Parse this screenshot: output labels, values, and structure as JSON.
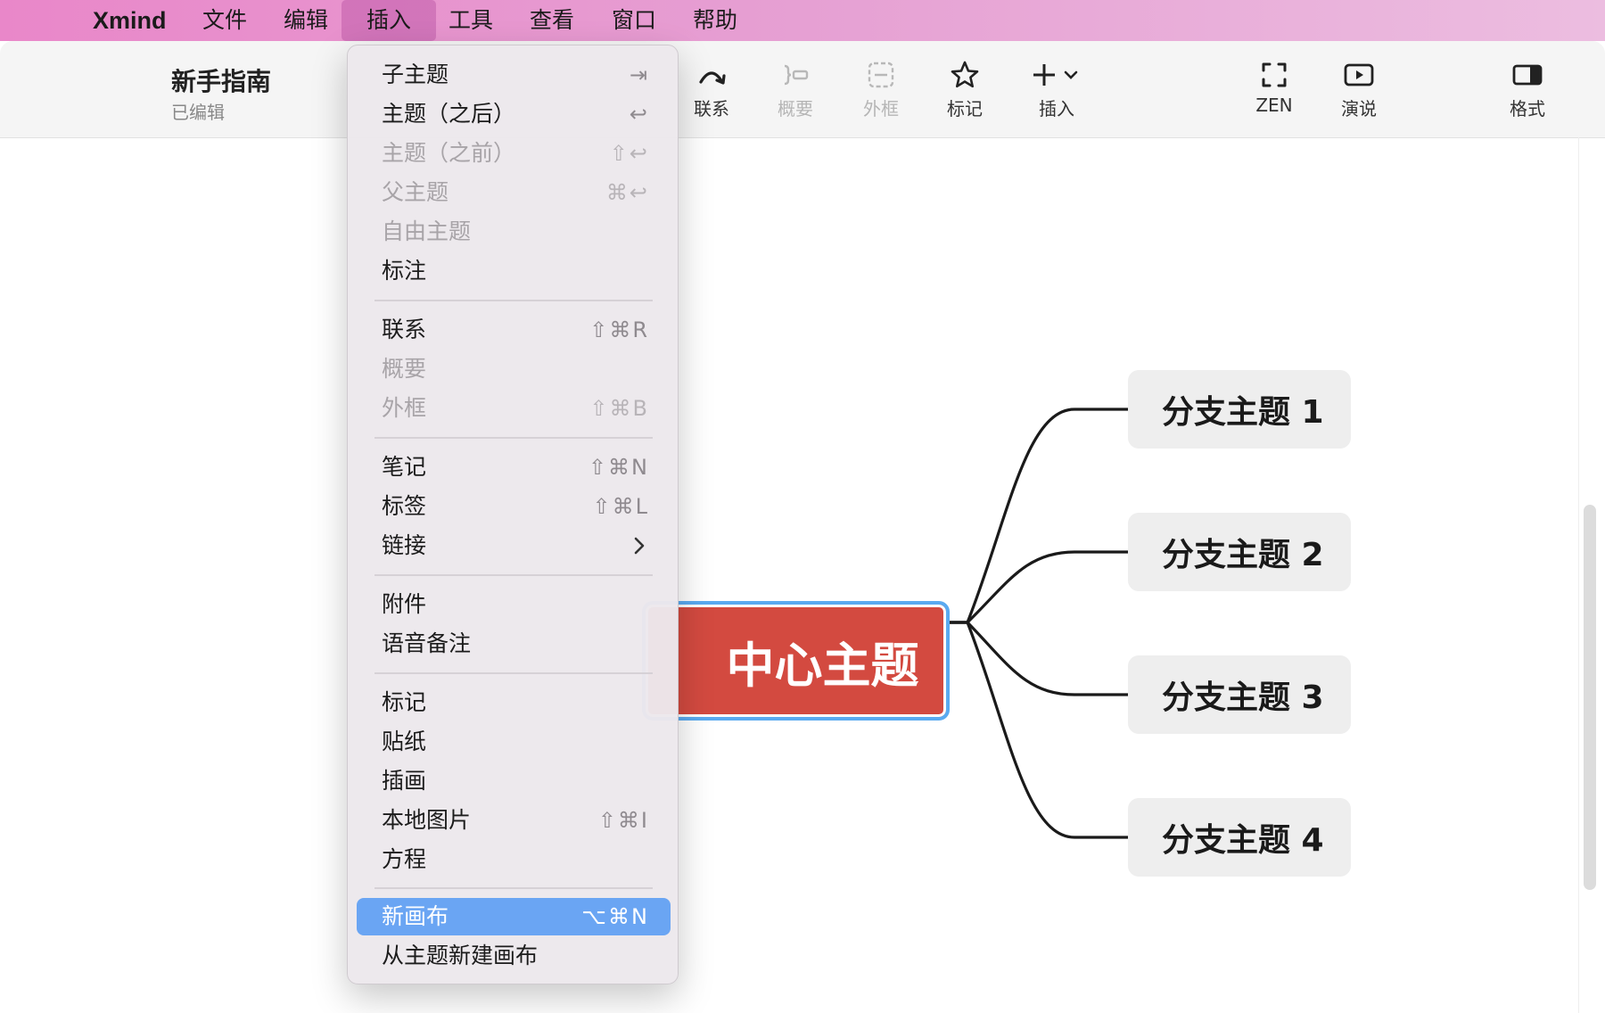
{
  "menubar": {
    "app": "Xmind",
    "items": [
      "文件",
      "编辑",
      "插入",
      "工具",
      "查看",
      "窗口",
      "帮助"
    ]
  },
  "document": {
    "title": "新手指南",
    "status": "已编辑"
  },
  "toolbar": {
    "relation": "联系",
    "summary": "概要",
    "boundary": "外框",
    "marker": "标记",
    "insert": "插入",
    "zen": "ZEN",
    "present": "演说",
    "format": "格式"
  },
  "insert_menu": {
    "items": [
      {
        "label": "子主题",
        "shortcut": "⇥",
        "enabled": true
      },
      {
        "label": "主题（之后）",
        "shortcut": "↩",
        "enabled": true
      },
      {
        "label": "主题（之前）",
        "shortcut": "⇧↩",
        "enabled": false
      },
      {
        "label": "父主题",
        "shortcut": "⌘↩",
        "enabled": false
      },
      {
        "label": "自由主题",
        "shortcut": "",
        "enabled": false
      },
      {
        "label": "标注",
        "shortcut": "",
        "enabled": true
      },
      {
        "label": "联系",
        "shortcut": "⇧⌘R",
        "enabled": true
      },
      {
        "label": "概要",
        "shortcut": "",
        "enabled": false
      },
      {
        "label": "外框",
        "shortcut": "⇧⌘B",
        "enabled": false
      },
      {
        "label": "笔记",
        "shortcut": "⇧⌘N",
        "enabled": true
      },
      {
        "label": "标签",
        "shortcut": "⇧⌘L",
        "enabled": true
      },
      {
        "label": "链接",
        "shortcut": "",
        "enabled": true,
        "submenu": true
      },
      {
        "label": "附件",
        "shortcut": "",
        "enabled": true
      },
      {
        "label": "语音备注",
        "shortcut": "",
        "enabled": true
      },
      {
        "label": "标记",
        "shortcut": "",
        "enabled": true
      },
      {
        "label": "贴纸",
        "shortcut": "",
        "enabled": true
      },
      {
        "label": "插画",
        "shortcut": "",
        "enabled": true
      },
      {
        "label": "本地图片",
        "shortcut": "⇧⌘I",
        "enabled": true
      },
      {
        "label": "方程",
        "shortcut": "",
        "enabled": true
      },
      {
        "label": "新画布",
        "shortcut": "⌥⌘N",
        "enabled": true,
        "highlighted": true
      },
      {
        "label": "从主题新建画布",
        "shortcut": "",
        "enabled": true
      }
    ]
  },
  "mindmap": {
    "central": "中心主题",
    "branches": [
      "分支主题 1",
      "分支主题 2",
      "分支主题 3",
      "分支主题 4"
    ]
  },
  "colors": {
    "central_fill": "#d34a40",
    "selection_border": "#5aaaf0",
    "menu_highlight": "#6aa5f3",
    "branch_fill": "#eeeeee"
  }
}
